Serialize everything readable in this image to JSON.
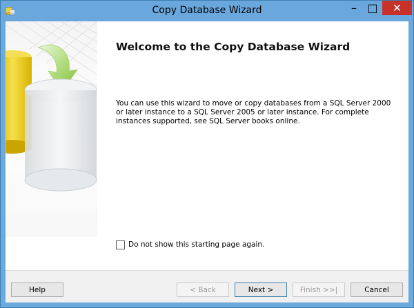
{
  "window": {
    "title": "Copy Database Wizard",
    "minimize_glyph": "–",
    "maximize_glyph": "□",
    "close_glyph": "✕",
    "accent_color": "#6aa7dc",
    "close_color": "#c7312a"
  },
  "page": {
    "heading": "Welcome to the Copy Database Wizard",
    "description": "You can use this wizard to move or copy databases from a SQL Server 2000 or later instance to a SQL Server 2005 or later instance. For complete instances supported, see SQL Server books online.",
    "dont_show_label": "Do not show this starting page again.",
    "dont_show_checked": false
  },
  "buttons": {
    "help": "Help",
    "back": "< Back",
    "next": "Next >",
    "finish": "Finish >>|",
    "cancel": "Cancel"
  },
  "icons": {
    "app": "database-wizard-icon",
    "side_graphic": "database-copy-illustration"
  }
}
